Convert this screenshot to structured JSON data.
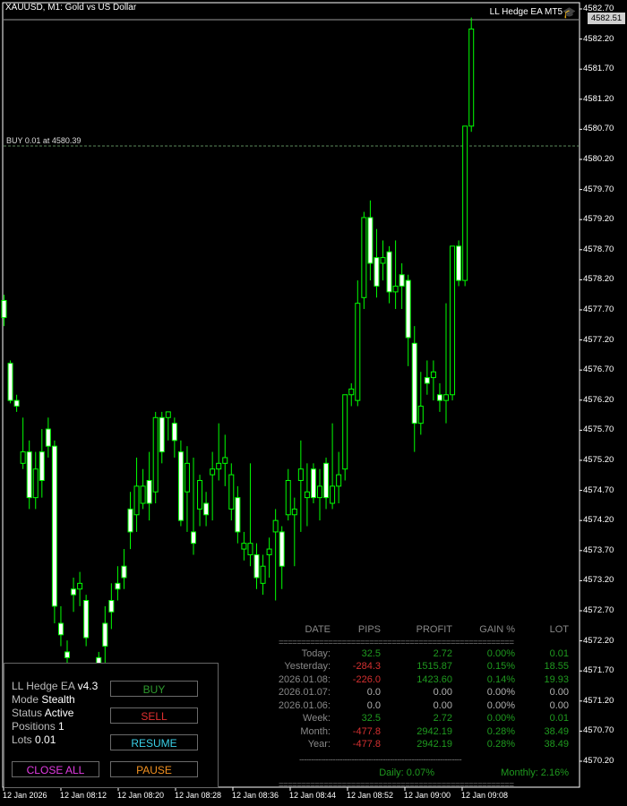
{
  "window": {
    "title": "XAUUSD, M1:  Gold vs US Dollar",
    "ea_label": "LL Hedge EA MT5",
    "current_price": "4582.51",
    "buy_line_label": "BUY 0.01 at 4580.39"
  },
  "colors": {
    "background": "#000000",
    "candle": "#00ff00",
    "border": "#ffffff",
    "profit": "#1f9a1f",
    "loss": "#d43030"
  },
  "price_axis": [
    "4582.70",
    "4582.20",
    "4581.70",
    "4581.20",
    "4580.70",
    "4580.20",
    "4579.70",
    "4579.20",
    "4578.70",
    "4578.20",
    "4577.70",
    "4577.20",
    "4576.70",
    "4576.20",
    "4575.70",
    "4575.20",
    "4574.70",
    "4574.20",
    "4573.70",
    "4573.20",
    "4572.70",
    "4572.20",
    "4571.70",
    "4571.20",
    "4570.70",
    "4570.20"
  ],
  "time_axis": [
    "12 Jan 2026",
    "12 Jan 08:12",
    "12 Jan 08:20",
    "12 Jan 08:28",
    "12 Jan 08:36",
    "12 Jan 08:44",
    "12 Jan 08:52",
    "12 Jan 09:00",
    "12 Jan 09:08"
  ],
  "panel": {
    "ea_name": "LL Hedge EA",
    "version": "v4.3",
    "mode_label": "Mode",
    "mode_value": "Stealth",
    "status_label": "Status",
    "status_value": "Active",
    "positions_label": "Positions",
    "positions_value": "1",
    "lots_label": "Lots",
    "lots_value": "0.01",
    "buttons": {
      "buy": "BUY",
      "sell": "SELL",
      "resume": "RESUME",
      "close_all": "CLOSE ALL",
      "pause": "PAUSE"
    }
  },
  "stats": {
    "headers": [
      "DATE",
      "PIPS",
      "PROFIT",
      "GAIN %",
      "LOT"
    ],
    "separator": "====================================================",
    "rows": [
      {
        "date": "Today:",
        "pips": "32.5",
        "profit": "2.72",
        "gain": "0.00%",
        "lot": "0.01",
        "sign": "pos"
      },
      {
        "date": "Yesterday:",
        "pips": "-284.3",
        "profit": "1515.87",
        "gain": "0.15%",
        "lot": "18.55",
        "sign": "neg"
      },
      {
        "date": "2026.01.08:",
        "pips": "-226.0",
        "profit": "1423.60",
        "gain": "0.14%",
        "lot": "19.93",
        "sign": "neg"
      },
      {
        "date": "2026.01.07:",
        "pips": "0.0",
        "profit": "0.00",
        "gain": "0.00%",
        "lot": "0.00",
        "sign": "zero"
      },
      {
        "date": "2026.01.06:",
        "pips": "0.0",
        "profit": "0.00",
        "gain": "0.00%",
        "lot": "0.00",
        "sign": "zero"
      },
      {
        "date": "Week:",
        "pips": "32.5",
        "profit": "2.72",
        "gain": "0.00%",
        "lot": "0.01",
        "sign": "pos"
      },
      {
        "date": "Month:",
        "pips": "-477.8",
        "profit": "2942.19",
        "gain": "0.28%",
        "lot": "38.49",
        "sign": "neg"
      },
      {
        "date": "Year:",
        "pips": "-477.8",
        "profit": "2942.19",
        "gain": "0.28%",
        "lot": "38.49",
        "sign": "neg"
      }
    ],
    "dash_separator": "--------------------------------------------------------------------",
    "daily": "Daily: 0.07%",
    "monthly": "Monthly: 2.16%"
  },
  "chart_data": {
    "type": "candlestick",
    "symbol": "XAUUSD",
    "timeframe": "M1",
    "ylim": [
      4569.85,
      4582.95
    ],
    "candles": [
      [
        4577.85,
        4577.95,
        4577.4,
        4577.55
      ],
      [
        4576.75,
        4576.8,
        4576.05,
        4576.1
      ],
      [
        4576.1,
        4576.2,
        4575.9,
        4576.0
      ],
      [
        4575.0,
        4575.8,
        4574.9,
        4575.2
      ],
      [
        4575.2,
        4575.4,
        4574.2,
        4574.4
      ],
      [
        4574.4,
        4575.2,
        4574.2,
        4574.9
      ],
      [
        4575.2,
        4575.6,
        4574.4,
        4574.7
      ],
      [
        4575.6,
        4575.8,
        4575.1,
        4575.3
      ],
      [
        4575.3,
        4575.4,
        4572.2,
        4572.5
      ],
      [
        4572.2,
        4572.5,
        4571.8,
        4572.0
      ],
      [
        4571.7,
        4571.9,
        4571.3,
        4571.6
      ],
      [
        4572.8,
        4573.0,
        4572.4,
        4572.7
      ],
      [
        4572.8,
        4573.1,
        4572.5,
        4572.9
      ],
      [
        4572.6,
        4572.7,
        4571.8,
        4571.95
      ],
      [
        4571.3,
        4571.5,
        4570.9,
        4571.2
      ],
      [
        4571.6,
        4571.7,
        4571.1,
        4571.3
      ],
      [
        4572.2,
        4572.5,
        4571.5,
        4571.8
      ],
      [
        4572.6,
        4572.9,
        4572.1,
        4572.4
      ],
      [
        4572.9,
        4573.2,
        4572.6,
        4572.8
      ],
      [
        4573.2,
        4573.5,
        4572.8,
        4573.0
      ],
      [
        4574.2,
        4574.5,
        4573.5,
        4573.8
      ],
      [
        4574.1,
        4575.1,
        4573.8,
        4574.6
      ],
      [
        4574.3,
        4574.9,
        4574.2,
        4574.6
      ],
      [
        4574.7,
        4575.2,
        4574.0,
        4574.3
      ],
      [
        4574.5,
        4575.9,
        4574.3,
        4575.8
      ],
      [
        4575.8,
        4575.9,
        4575.0,
        4575.2
      ],
      [
        4575.8,
        4575.9,
        4575.4,
        4575.9
      ],
      [
        4575.7,
        4575.8,
        4575.1,
        4575.4
      ],
      [
        4575.2,
        4575.4,
        4573.9,
        4574.0
      ],
      [
        4574.5,
        4575.3,
        4573.8,
        4575.0
      ],
      [
        4573.8,
        4575.1,
        4573.4,
        4573.6
      ],
      [
        4574.2,
        4574.8,
        4573.9,
        4574.7
      ],
      [
        4574.3,
        4574.5,
        4573.9,
        4574.1
      ],
      [
        4574.8,
        4575.2,
        4574.0,
        4574.9
      ],
      [
        4574.9,
        4575.7,
        4574.7,
        4575.0
      ],
      [
        4575.0,
        4575.5,
        4574.6,
        4575.1
      ],
      [
        4574.2,
        4575.0,
        4574.0,
        4574.8
      ],
      [
        4574.4,
        4574.6,
        4573.6,
        4573.8
      ],
      [
        4573.5,
        4573.8,
        4573.3,
        4573.6
      ],
      [
        4573.4,
        4575.0,
        4573.2,
        4573.6
      ],
      [
        4573.4,
        4573.6,
        4572.8,
        4573.0
      ],
      [
        4572.9,
        4573.4,
        4572.7,
        4573.2
      ],
      [
        4573.4,
        4573.7,
        4573.0,
        4573.5
      ],
      [
        4573.8,
        4574.2,
        4572.6,
        4574.0
      ],
      [
        4573.8,
        4573.9,
        4572.8,
        4573.2
      ],
      [
        4574.1,
        4574.9,
        4574.0,
        4574.7
      ],
      [
        4574.1,
        4574.4,
        4573.2,
        4574.2
      ],
      [
        4574.7,
        4575.4,
        4573.8,
        4574.9
      ],
      [
        4574.4,
        4575.0,
        4573.9,
        4574.5
      ],
      [
        4574.9,
        4575.0,
        4574.3,
        4574.4
      ],
      [
        4574.4,
        4574.9,
        4574.0,
        4574.6
      ],
      [
        4575.0,
        4575.1,
        4574.2,
        4574.4
      ],
      [
        4574.3,
        4575.7,
        4574.2,
        4574.6
      ],
      [
        4574.6,
        4575.2,
        4574.3,
        4574.8
      ],
      [
        4574.9,
        4576.2,
        4574.7,
        4576.2
      ],
      [
        4576.2,
        4576.4,
        4576.0,
        4576.3
      ],
      [
        4576.1,
        4578.2,
        4576.0,
        4577.8
      ],
      [
        4577.9,
        4579.4,
        4577.7,
        4579.3
      ],
      [
        4579.3,
        4579.6,
        4578.2,
        4578.5
      ],
      [
        4578.6,
        4579.1,
        4577.9,
        4578.1
      ],
      [
        4578.5,
        4578.9,
        4578.2,
        4578.6
      ],
      [
        4578.7,
        4578.8,
        4577.8,
        4578.0
      ],
      [
        4578.0,
        4578.9,
        4577.7,
        4578.1
      ],
      [
        4578.3,
        4578.5,
        4577.7,
        4578.1
      ],
      [
        4578.2,
        4578.3,
        4576.7,
        4577.2
      ],
      [
        4577.1,
        4577.4,
        4575.2,
        4575.7
      ],
      [
        4575.7,
        4576.6,
        4575.5,
        4576.0
      ],
      [
        4576.5,
        4576.8,
        4576.2,
        4576.4
      ],
      [
        4576.5,
        4576.8,
        4576.1,
        4576.6
      ],
      [
        4576.2,
        4576.4,
        4575.9,
        4576.1
      ],
      [
        4576.1,
        4577.8,
        4575.7,
        4576.2
      ],
      [
        4576.2,
        4578.6,
        4576.1,
        4578.8
      ],
      [
        4578.8,
        4578.9,
        4578.1,
        4578.2
      ],
      [
        4578.2,
        4580.9,
        4578.1,
        4580.9
      ],
      [
        4580.9,
        4582.8,
        4580.8,
        4582.6
      ]
    ]
  }
}
